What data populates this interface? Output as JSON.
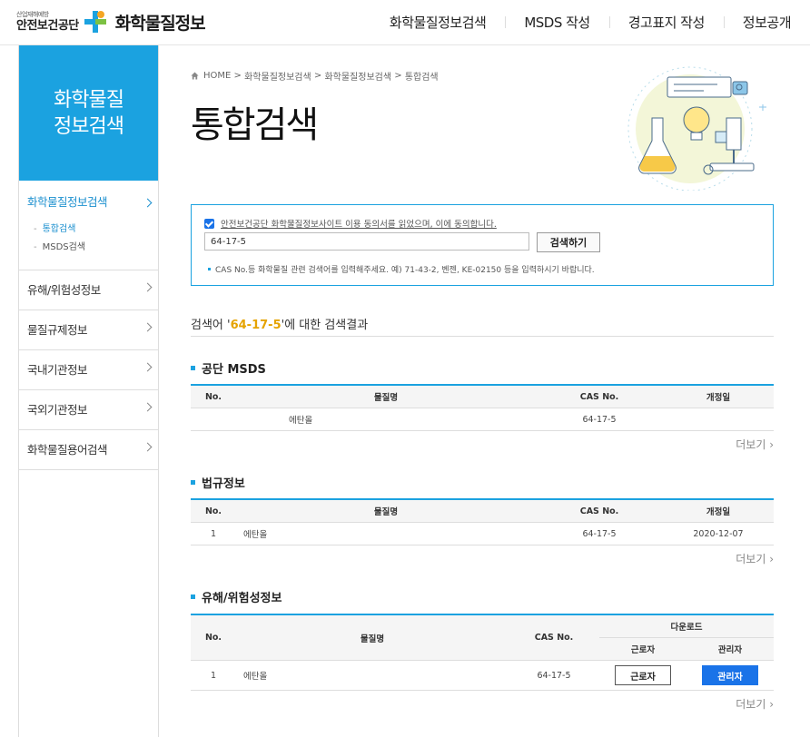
{
  "header": {
    "agency_sub": "산업재해예방",
    "agency_name": "안전보건공단",
    "site_title": "화학물질정보",
    "nav": [
      "화학물질정보검색",
      "MSDS 작성",
      "경고표지 작성",
      "정보공개"
    ]
  },
  "sidebar": {
    "heading_line1": "화학물질",
    "heading_line2": "정보검색",
    "groups": [
      {
        "label": "화학물질정보검색",
        "active": true,
        "subitems": [
          "통합검색",
          "MSDS검색"
        ]
      },
      {
        "label": "유해/위험성정보"
      },
      {
        "label": "물질규제정보"
      },
      {
        "label": "국내기관정보"
      },
      {
        "label": "국외기관정보"
      },
      {
        "label": "화학물질용어검색"
      }
    ]
  },
  "breadcrumb": [
    "HOME",
    "화학물질정보검색",
    "화학물질정보검색",
    "통합검색"
  ],
  "page_title": "통합검색",
  "search": {
    "agree_text": "안전보건공단 화학물질정보사이트 이용 동의서를 읽었으며, 이에 동의합니다.",
    "agree_checked": true,
    "query": "64-17-5",
    "button_label": "검색하기",
    "hint": "CAS No.등 화학물질 관련 검색어를 입력해주세요. 예) 71-43-2, 벤젠, KE-02150 등을 입력하시기 바랍니다."
  },
  "result_summary": {
    "prefix": "검색어 '",
    "keyword": "64-17-5",
    "suffix": "'에 대한 검색결과"
  },
  "more_label": "더보기",
  "sections": {
    "msds": {
      "title": "공단 MSDS",
      "headers": [
        "No.",
        "물질명",
        "CAS No.",
        "개정일"
      ],
      "rows": [
        [
          "",
          "에탄올",
          "64-17-5",
          ""
        ]
      ]
    },
    "law": {
      "title": "법규정보",
      "headers": [
        "No.",
        "물질명",
        "CAS No.",
        "개정일"
      ],
      "rows": [
        [
          "1",
          "에탄올",
          "64-17-5",
          "2020-12-07"
        ]
      ]
    },
    "hazard": {
      "title": "유해/위험성정보",
      "headers": [
        "No.",
        "물질명",
        "CAS No.",
        "다운로드",
        "근로자",
        "관리자"
      ],
      "rows": [
        {
          "no": "1",
          "name": "에탄올",
          "cas": "64-17-5",
          "worker_btn": "근로자",
          "manager_btn": "관리자"
        }
      ]
    }
  },
  "colors": {
    "accent": "#1ba2e0",
    "button_blue": "#1a73e8",
    "keyword": "#e5a300"
  }
}
